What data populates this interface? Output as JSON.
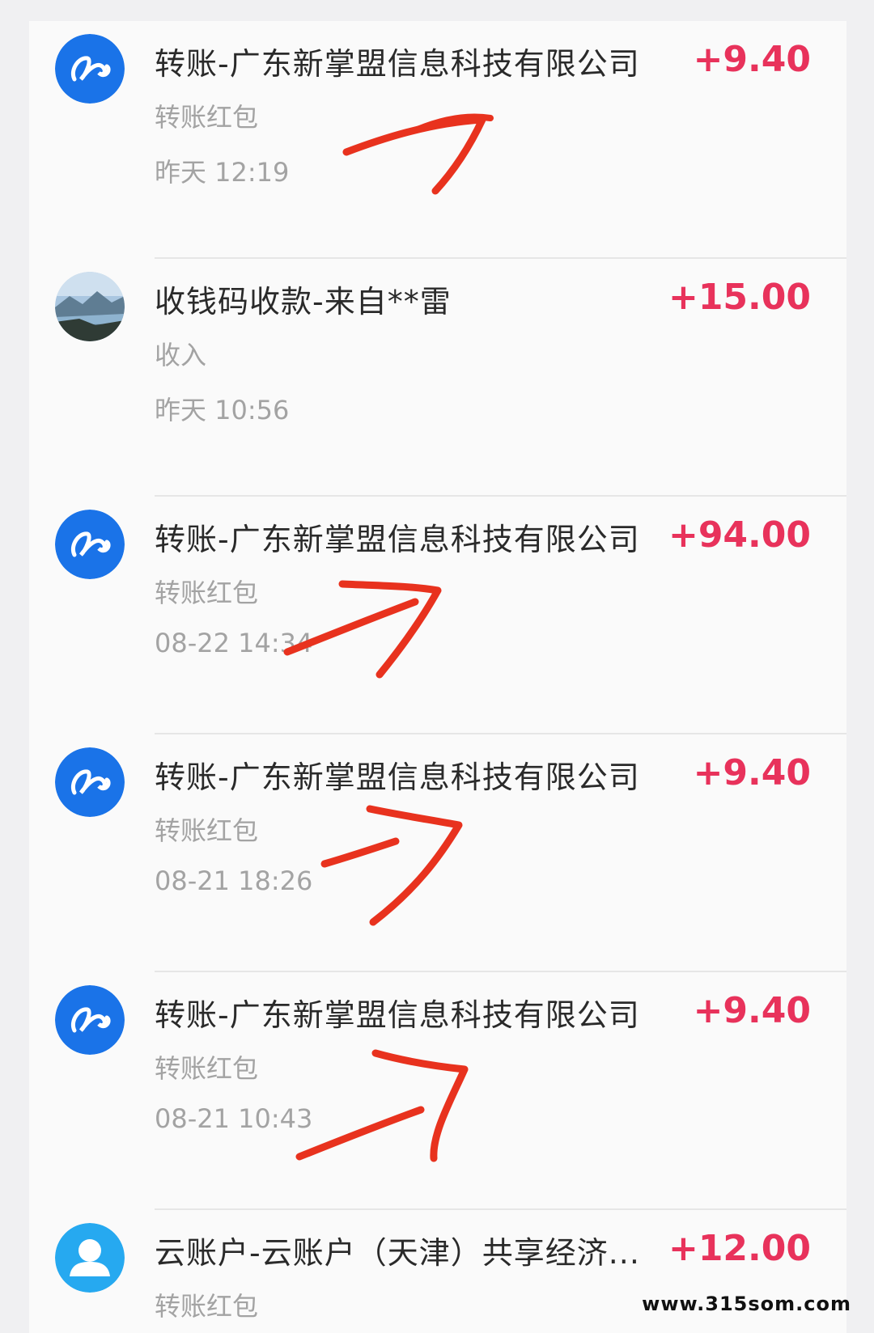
{
  "transactions": [
    {
      "title": "转账-广东新掌盟信息科技有限公司",
      "amount": "+9.40",
      "subtitle": "转账红包",
      "time": "昨天 12:19",
      "icon": "transfer-logo-icon"
    },
    {
      "title": "收钱码收款-来自**雷",
      "amount": "+15.00",
      "subtitle": "收入",
      "time": "昨天 10:56",
      "icon": "landscape-avatar"
    },
    {
      "title": "转账-广东新掌盟信息科技有限公司",
      "amount": "+94.00",
      "subtitle": "转账红包",
      "time": "08-22 14:34",
      "icon": "transfer-logo-icon"
    },
    {
      "title": "转账-广东新掌盟信息科技有限公司",
      "amount": "+9.40",
      "subtitle": "转账红包",
      "time": "08-21 18:26",
      "icon": "transfer-logo-icon"
    },
    {
      "title": "转账-广东新掌盟信息科技有限公司",
      "amount": "+9.40",
      "subtitle": "转账红包",
      "time": "08-21 10:43",
      "icon": "transfer-logo-icon"
    },
    {
      "title": "云账户-云账户（天津）共享经济...",
      "amount": "+12.00",
      "subtitle": "转账红包",
      "time": "",
      "icon": "user-avatar-icon"
    }
  ],
  "watermark": "www.315som.com",
  "colors": {
    "amount": "#e8325b",
    "logo_blue": "#1a73e8",
    "user_blue": "#26a9f0",
    "arrow_red": "#e8321e"
  }
}
